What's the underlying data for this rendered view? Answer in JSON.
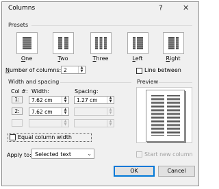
{
  "dialog": {
    "title": "Columns",
    "help_glyph": "?",
    "close_glyph": "✕"
  },
  "presets": {
    "label": "Presets",
    "items": [
      {
        "label": "One",
        "key": "O",
        "rest": "ne",
        "icon": "one-column-icon",
        "selected": false
      },
      {
        "label": "Two",
        "key": "T",
        "rest": "wo",
        "icon": "two-column-icon",
        "selected": false
      },
      {
        "label": "Three",
        "key": "T",
        "rest": "hree",
        "icon": "three-column-icon",
        "selected": false
      },
      {
        "label": "Left",
        "key": "L",
        "rest": "eft",
        "icon": "left-column-icon",
        "selected": false
      },
      {
        "label": "Right",
        "key": "R",
        "rest": "ight",
        "icon": "right-column-icon",
        "selected": false
      }
    ]
  },
  "number_of_columns": {
    "label": "Number of columns:",
    "key": "N",
    "rest": "umber of columns:",
    "value": "2"
  },
  "line_between": {
    "label": "Line between",
    "key": "B",
    "checked": false
  },
  "width_spacing": {
    "label": "Width and spacing",
    "col_header": "Col #:",
    "width_header": "Width:",
    "spacing_header": "Spacing:",
    "rows": [
      {
        "col": "1:",
        "width": "7.62 cm",
        "spacing": "1.27 cm",
        "enabled": true,
        "spacing_enabled": true
      },
      {
        "col": "2:",
        "width": "7.62 cm",
        "spacing": "",
        "enabled": true,
        "spacing_enabled": false
      },
      {
        "col": "",
        "width": "",
        "spacing": "",
        "enabled": false,
        "spacing_enabled": false
      }
    ]
  },
  "equal_width": {
    "label": "Equal column width",
    "checked": false
  },
  "preview": {
    "label": "Preview"
  },
  "apply_to": {
    "label": "Apply to:",
    "value": "Selected text"
  },
  "start_new_column": {
    "label": "Start new column",
    "checked": false,
    "enabled": false
  },
  "buttons": {
    "ok": "OK",
    "cancel": "Cancel"
  },
  "colors": {
    "dialog_bg": "#f0f0f0",
    "accent": "#0078d7",
    "disabled_text": "#9e9e9e"
  }
}
